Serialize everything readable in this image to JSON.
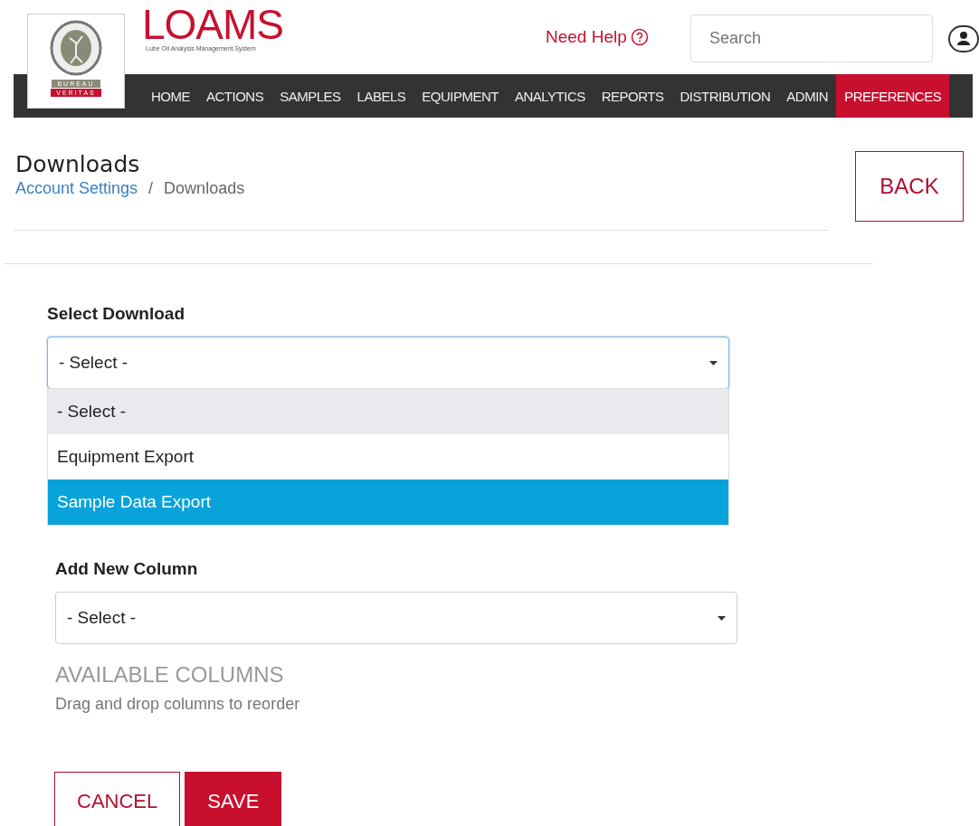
{
  "header": {
    "brand_top": "BUREAU",
    "brand_bottom": "VERITAS",
    "logo": "LOAMS",
    "logo_subtitle": "Lube Oil Analysis Management System",
    "help_link": "Need Help",
    "search": {
      "placeholder": "Search"
    }
  },
  "nav": [
    {
      "label": "HOME",
      "selected": false
    },
    {
      "label": "ACTIONS",
      "selected": false
    },
    {
      "label": "SAMPLES",
      "selected": false
    },
    {
      "label": "LABELS",
      "selected": false
    },
    {
      "label": "EQUIPMENT",
      "selected": false
    },
    {
      "label": "ANALYTICS",
      "selected": false
    },
    {
      "label": "REPORTS",
      "selected": false
    },
    {
      "label": "DISTRIBUTION",
      "selected": false
    },
    {
      "label": "ADMIN",
      "selected": false
    },
    {
      "label": "PREFERENCES",
      "selected": true
    }
  ],
  "page": {
    "title": "Downloads",
    "breadcrumb": [
      {
        "label": "Account Settings",
        "kind": "link"
      },
      {
        "label": "Downloads",
        "kind": "current"
      }
    ],
    "separator": "/",
    "back_button": "BACK"
  },
  "select_download": {
    "label": "Select Download",
    "value": "- Select -",
    "expanded": true,
    "options": [
      {
        "label": "- Select -",
        "selected": true,
        "highlighted": false
      },
      {
        "label": "Equipment Export",
        "selected": false,
        "highlighted": false
      },
      {
        "label": "Sample Data Export",
        "selected": false,
        "highlighted": true
      }
    ]
  },
  "add_column": {
    "label": "Add New Column",
    "value": "- Select -"
  },
  "available_columns": {
    "title": "AVAILABLE COLUMNS",
    "hint": "Drag and drop columns to reorder"
  },
  "buttons": [
    {
      "label": "CANCEL",
      "kind": "secondary"
    },
    {
      "label": "SAVE",
      "kind": "primary"
    }
  ]
}
